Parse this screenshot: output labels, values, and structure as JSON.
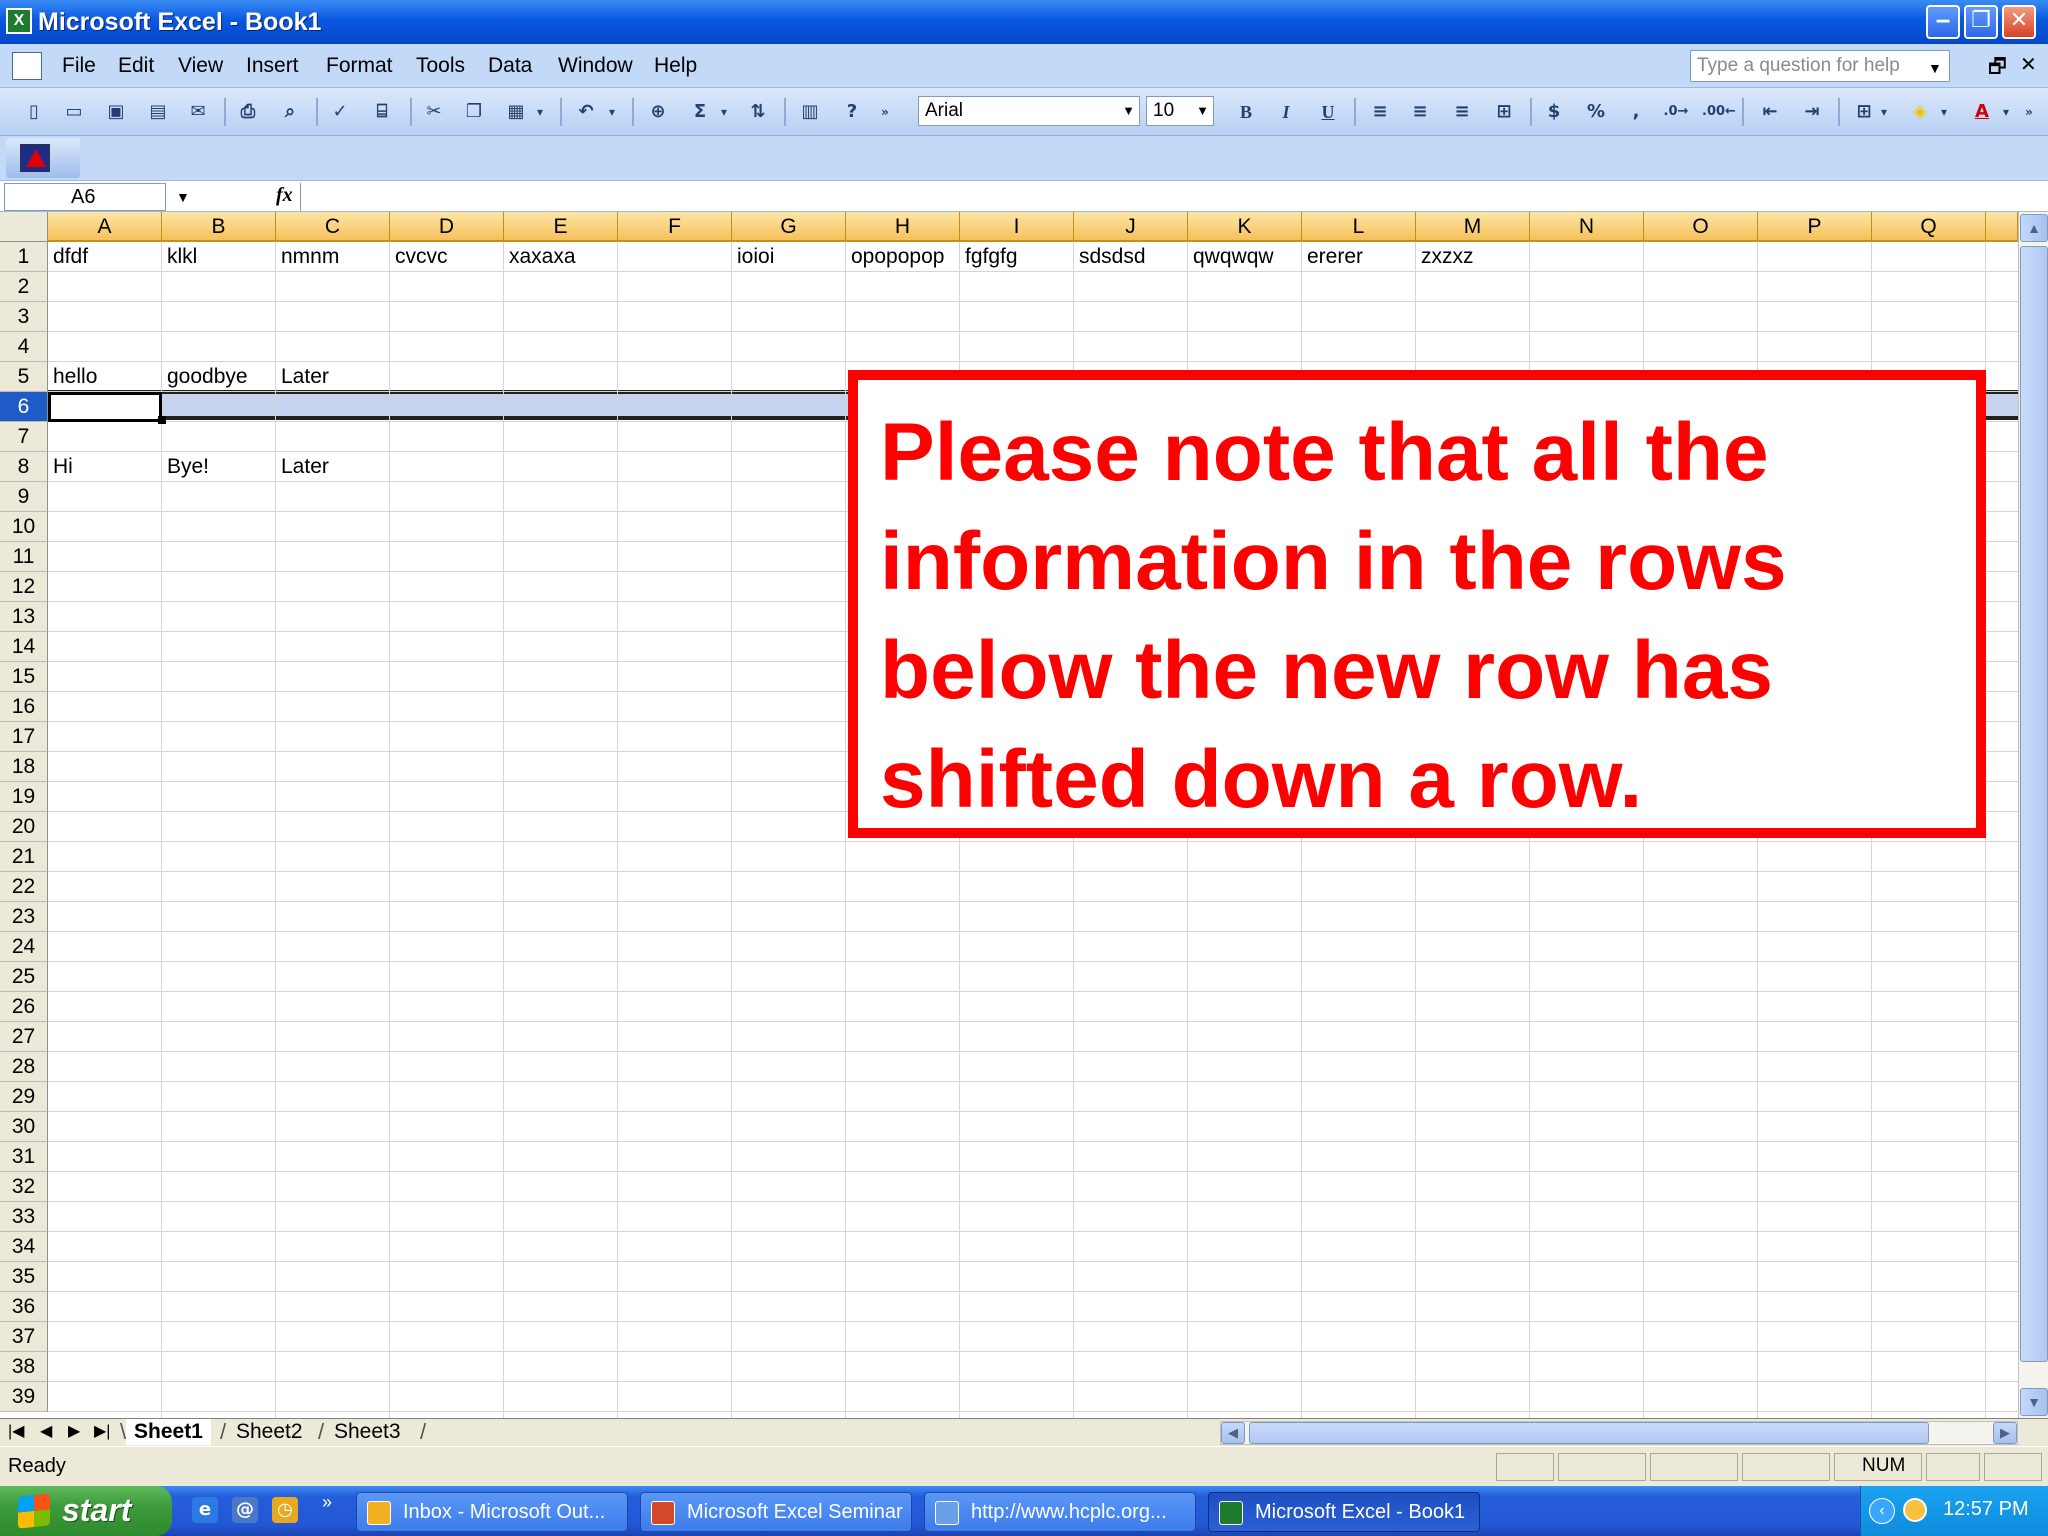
{
  "window": {
    "title": "Microsoft Excel - Book1",
    "app_icon": "X",
    "minimize": "‒",
    "restore": "❐",
    "close": "✕"
  },
  "menubar": {
    "items": [
      "File",
      "Edit",
      "View",
      "Insert",
      "Format",
      "Tools",
      "Data",
      "Window",
      "Help"
    ],
    "help_placeholder": "Type a question for help",
    "doc_restore": "🗗",
    "doc_close": "✕"
  },
  "toolbar": {
    "font": "Arial",
    "size": "10",
    "bold": "B",
    "italic": "I",
    "underline": "U",
    "currency": "$",
    "percent": "%",
    "comma": ",",
    "sum": "Σ"
  },
  "formula_bar": {
    "name_box": "A6",
    "fx": "fx",
    "value": ""
  },
  "sheet": {
    "columns": [
      "A",
      "B",
      "C",
      "D",
      "E",
      "F",
      "G",
      "H",
      "I",
      "J",
      "K",
      "L",
      "M",
      "N",
      "O",
      "P",
      "Q"
    ],
    "row_numbers": [
      "1",
      "2",
      "3",
      "4",
      "5",
      "6",
      "7",
      "8",
      "9",
      "10",
      "11",
      "12",
      "13",
      "14",
      "15",
      "16",
      "17",
      "18",
      "19",
      "20",
      "21",
      "22",
      "23",
      "24",
      "25",
      "26",
      "27",
      "28",
      "29",
      "30",
      "31",
      "32",
      "33",
      "34",
      "35",
      "36",
      "37",
      "38",
      "39"
    ],
    "selected_row": "6",
    "cells": {
      "A1": "dfdf",
      "B1": "klkl",
      "C1": "nmnm",
      "D1": "cvcvc",
      "E1": "xaxaxa",
      "G1": "ioioi",
      "H1": "opopopop",
      "I1": "fgfgfg",
      "J1": "sdsdsd",
      "K1": "qwqwqw",
      "L1": "ererer",
      "M1": "zxzxz",
      "A5": "hello",
      "B5": "goodbye",
      "C5": "Later",
      "A8": "Hi",
      "B8": "Bye!",
      "C8": "Later"
    }
  },
  "callout": {
    "text": "Please note that all the information in the rows below the new row has shifted down a row.",
    "color": "#ff0000"
  },
  "sheet_tabs": {
    "tabs": [
      "Sheet1",
      "Sheet2",
      "Sheet3"
    ],
    "active": "Sheet1",
    "nav": [
      "|◀",
      "◀",
      "▶",
      "▶|"
    ]
  },
  "status": {
    "text": "Ready",
    "num": "NUM"
  },
  "taskbar": {
    "start": "start",
    "more": "»",
    "buttons": [
      "Inbox - Microsoft Out...",
      "Microsoft Excel Seminar",
      "http://www.hcplc.org...",
      "Microsoft Excel - Book1"
    ],
    "active": "Microsoft Excel - Book1",
    "time": "12:57 PM"
  }
}
